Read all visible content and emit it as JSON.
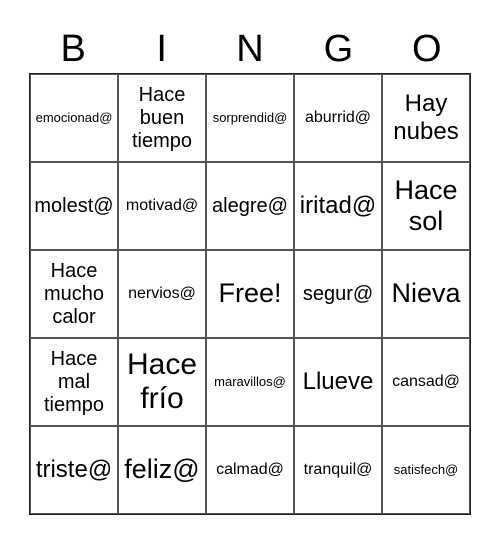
{
  "header": {
    "letters": [
      "B",
      "I",
      "N",
      "G",
      "O"
    ]
  },
  "board": {
    "rows": [
      [
        {
          "text": "emocionad@",
          "size": "xs"
        },
        {
          "text": "Hace buen tiempo",
          "size": "md"
        },
        {
          "text": "sorprendid@",
          "size": "xs"
        },
        {
          "text": "aburrid@",
          "size": "sm"
        },
        {
          "text": "Hay nubes",
          "size": "lg"
        }
      ],
      [
        {
          "text": "molest@",
          "size": "md"
        },
        {
          "text": "motivad@",
          "size": "sm"
        },
        {
          "text": "alegre@",
          "size": "md"
        },
        {
          "text": "iritad@",
          "size": "lg"
        },
        {
          "text": "Hace sol",
          "size": "xl"
        }
      ],
      [
        {
          "text": "Hace mucho calor",
          "size": "md"
        },
        {
          "text": "nervios@",
          "size": "sm"
        },
        {
          "text": "Free!",
          "size": "xl",
          "free": true
        },
        {
          "text": "segur@",
          "size": "md"
        },
        {
          "text": "Nieva",
          "size": "xl"
        }
      ],
      [
        {
          "text": "Hace mal tiempo",
          "size": "md"
        },
        {
          "text": "Hace frío",
          "size": "xxl"
        },
        {
          "text": "maravillos@",
          "size": "xs"
        },
        {
          "text": "Llueve",
          "size": "lg"
        },
        {
          "text": "cansad@",
          "size": "sm"
        }
      ],
      [
        {
          "text": "triste@",
          "size": "lg"
        },
        {
          "text": "feliz@",
          "size": "xl"
        },
        {
          "text": "calmad@",
          "size": "sm"
        },
        {
          "text": "tranquil@",
          "size": "sm"
        },
        {
          "text": "satisfech@",
          "size": "xs"
        }
      ]
    ]
  }
}
